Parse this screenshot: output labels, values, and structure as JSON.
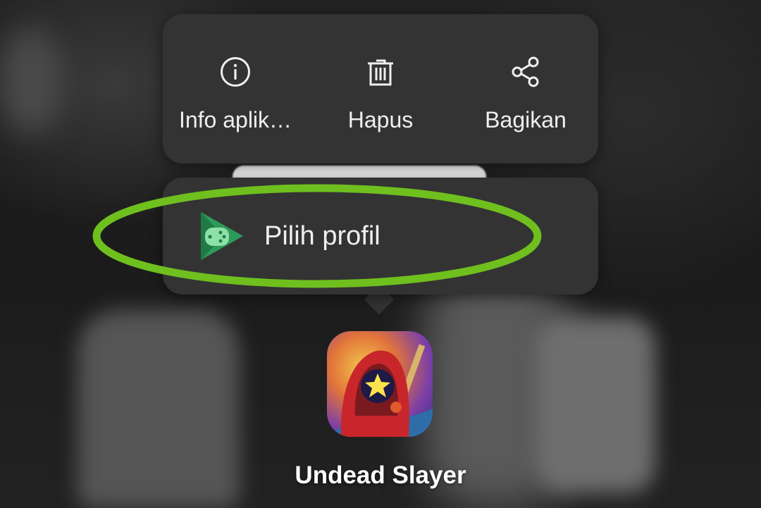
{
  "actions": [
    {
      "label": "Info aplik…",
      "icon": "info-icon"
    },
    {
      "label": "Hapus",
      "icon": "trash-icon"
    },
    {
      "label": "Bagikan",
      "icon": "share-icon"
    }
  ],
  "shortcut": {
    "label": "Pilih profil",
    "icon": "google-play-games-icon"
  },
  "app": {
    "name": "Undead Slayer",
    "icon": "undead-slayer-app-icon"
  },
  "colors": {
    "card_bg": "#333333",
    "text": "#efefef",
    "highlight": "#6fbf1f",
    "play_games_green": "#2e9a5a"
  }
}
